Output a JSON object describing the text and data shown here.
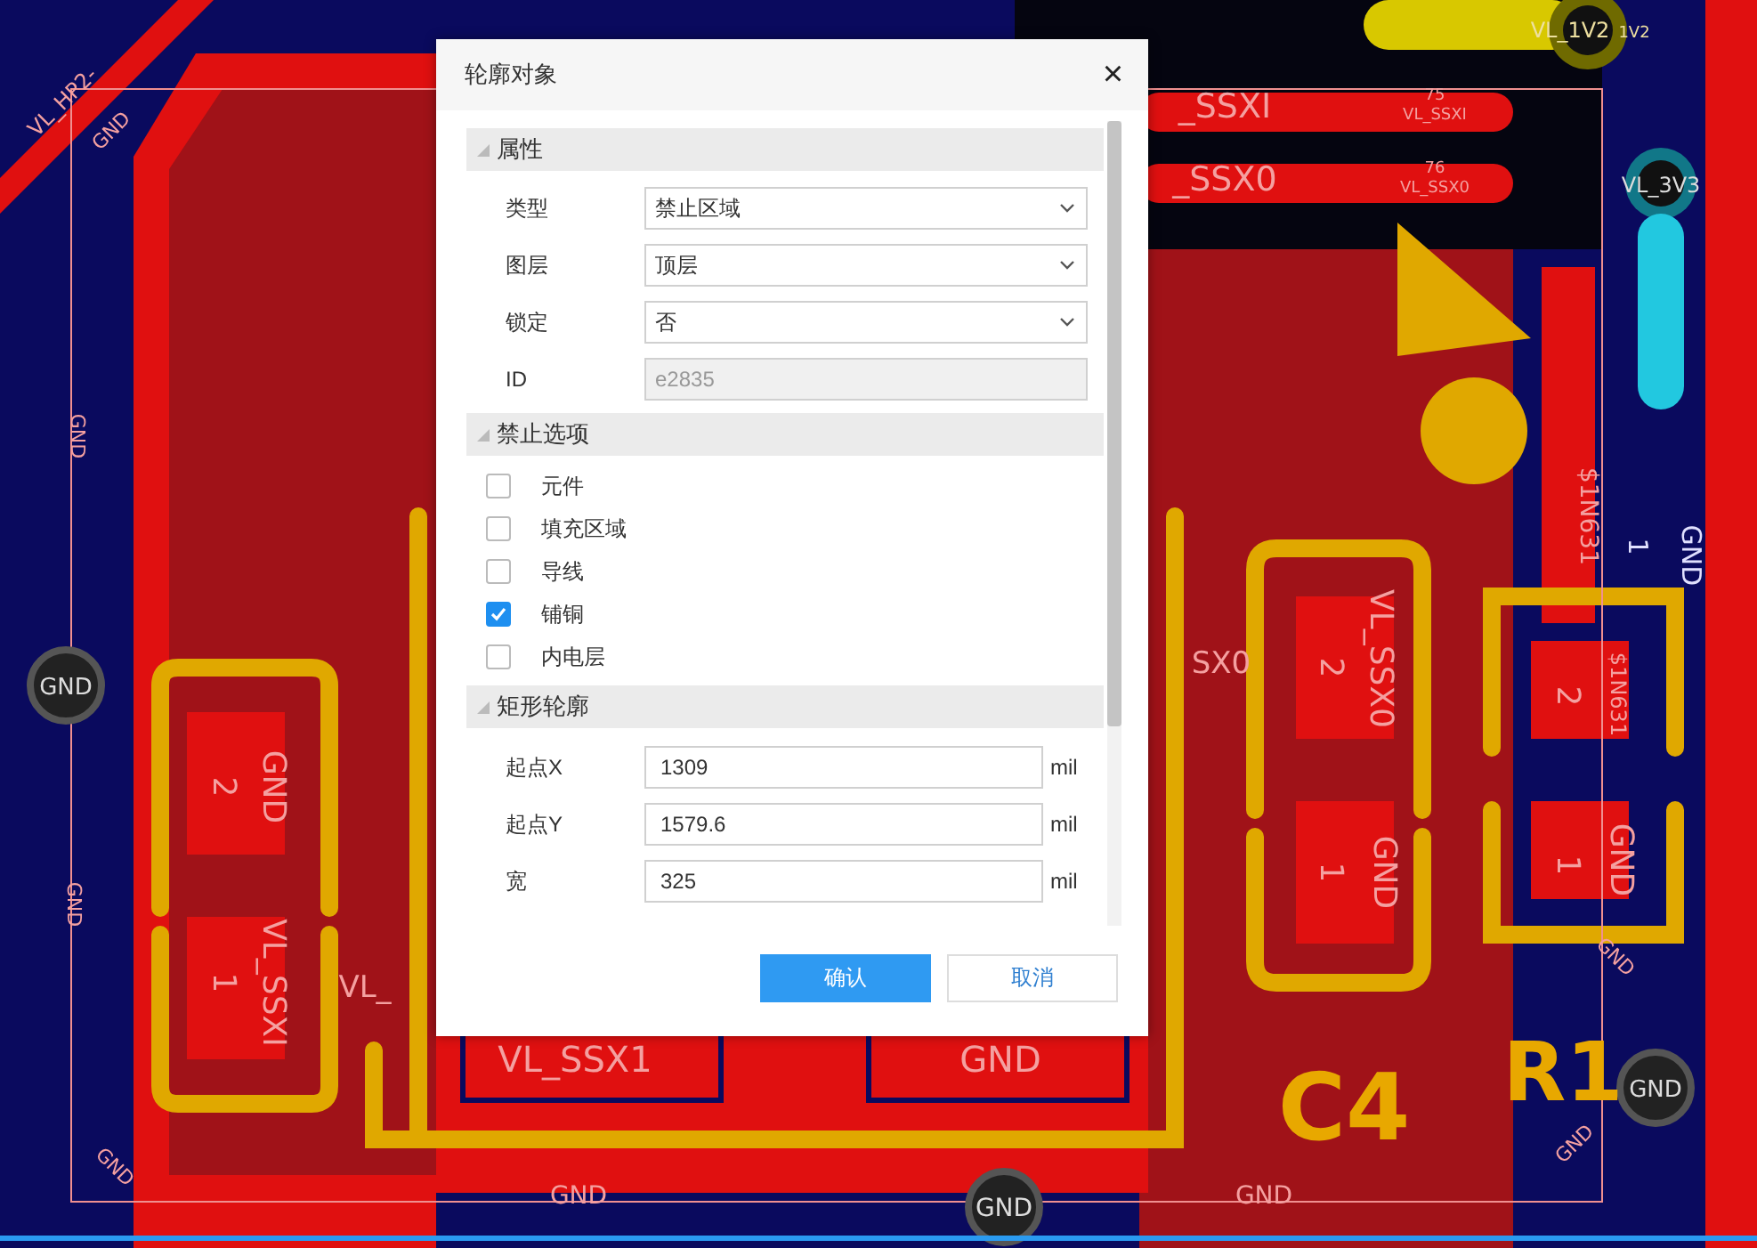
{
  "board_labels": [
    {
      "text": "VL_HP2-"
    },
    {
      "text": "GND"
    },
    {
      "text": "GND"
    },
    {
      "text": "GND"
    },
    {
      "text": "GND"
    },
    {
      "text": "GND"
    },
    {
      "text": "_SSXI"
    },
    {
      "text": "75"
    },
    {
      "text": "VL_SSXI"
    },
    {
      "text": "_SSX0"
    },
    {
      "text": "76"
    },
    {
      "text": "VL_SSX0"
    },
    {
      "text": "VL_1V2"
    },
    {
      "text": "1V2"
    },
    {
      "text": "VL_3V3"
    },
    {
      "text": "$1N631"
    },
    {
      "text": "GND"
    },
    {
      "text": "1"
    },
    {
      "text": "GND"
    },
    {
      "text": "2"
    },
    {
      "text": "VL_SSXI"
    },
    {
      "text": "1"
    },
    {
      "text": "VL_"
    },
    {
      "text": "VL_SSX1"
    },
    {
      "text": "GND"
    },
    {
      "text": "SX0"
    },
    {
      "text": "VL_SSX0"
    },
    {
      "text": "2"
    },
    {
      "text": "GND"
    },
    {
      "text": "1"
    },
    {
      "text": "2"
    },
    {
      "text": "$1N631"
    },
    {
      "text": "1"
    },
    {
      "text": "GND"
    },
    {
      "text": "C4"
    },
    {
      "text": "R1"
    },
    {
      "text": "GND"
    },
    {
      "text": "GND"
    },
    {
      "text": "GND"
    },
    {
      "text": "GND"
    },
    {
      "text": "GND"
    },
    {
      "text": "GND"
    }
  ],
  "dialog": {
    "title": "轮廓对象",
    "close": "×",
    "sections": [
      {
        "title": "属性",
        "rows": [
          {
            "kind": "select",
            "label": "类型",
            "value": "禁止区域",
            "disabled": false
          },
          {
            "kind": "select",
            "label": "图层",
            "value": "顶层",
            "disabled": false
          },
          {
            "kind": "select",
            "label": "锁定",
            "value": "否",
            "disabled": false
          },
          {
            "kind": "text",
            "label": "ID",
            "value": "e2835",
            "disabled": true
          }
        ]
      },
      {
        "title": "禁止选项",
        "rows": [
          {
            "kind": "checkbox",
            "label": "元件",
            "checked": false
          },
          {
            "kind": "checkbox",
            "label": "填充区域",
            "checked": false
          },
          {
            "kind": "checkbox",
            "label": "导线",
            "checked": false
          },
          {
            "kind": "checkbox",
            "label": "铺铜",
            "checked": true
          },
          {
            "kind": "checkbox",
            "label": "内电层",
            "checked": false
          }
        ]
      },
      {
        "title": "矩形轮廓",
        "rows": [
          {
            "kind": "number",
            "label": "起点X",
            "value": "1309",
            "unit": "mil"
          },
          {
            "kind": "number",
            "label": "起点Y",
            "value": "1579.6",
            "unit": "mil"
          },
          {
            "kind": "number",
            "label": "宽",
            "value": "325",
            "unit": "mil"
          }
        ]
      }
    ],
    "buttons": [
      {
        "label": "确认",
        "kind": "primary"
      },
      {
        "label": "取消",
        "kind": "secondary"
      }
    ]
  }
}
